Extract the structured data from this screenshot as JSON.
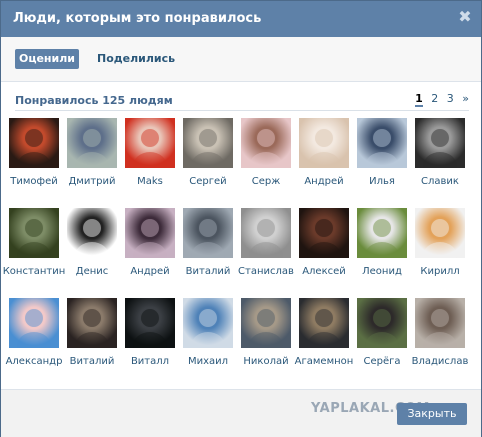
{
  "dialog": {
    "title": "Люди, которым это понравилось",
    "close_glyph": "✖",
    "tabs": [
      {
        "label": "Оценили",
        "active": true
      },
      {
        "label": "Поделились",
        "active": false
      }
    ],
    "summary": "Понравилось 125 людям",
    "pager": [
      "1",
      "2",
      "3",
      "»"
    ],
    "people": [
      {
        "name": "Тимофей",
        "c1": "#2a1a14",
        "c2": "#c24a2c"
      },
      {
        "name": "Дмитрий",
        "c1": "#a8b6b0",
        "c2": "#5e6f8a"
      },
      {
        "name": "Maks",
        "c1": "#d03020",
        "c2": "#e9c5b8"
      },
      {
        "name": "Сергей",
        "c1": "#6e6a63",
        "c2": "#c9c1b4"
      },
      {
        "name": "Серж",
        "c1": "#e7c6c8",
        "c2": "#9b6a5a"
      },
      {
        "name": "Андрей",
        "c1": "#d9c3ae",
        "c2": "#f3e9e0"
      },
      {
        "name": "Илья",
        "c1": "#b8c8d9",
        "c2": "#3a4d6a"
      },
      {
        "name": "Славик",
        "c1": "#2b2b2b",
        "c2": "#9a9a9a"
      },
      {
        "name": "Константин",
        "c1": "#34411f",
        "c2": "#7d8c66"
      },
      {
        "name": "Денис",
        "c1": "#ffffff",
        "c2": "#222222"
      },
      {
        "name": "Андрей",
        "c1": "#c7b0c2",
        "c2": "#3d2b3a"
      },
      {
        "name": "Виталий",
        "c1": "#9fa9b3",
        "c2": "#4c5560"
      },
      {
        "name": "Станислав",
        "c1": "#8f8f8f",
        "c2": "#d0d0d0"
      },
      {
        "name": "Алексей",
        "c1": "#1f1410",
        "c2": "#6a3a2a"
      },
      {
        "name": "Леонид",
        "c1": "#6a8c3c",
        "c2": "#e6e6e6"
      },
      {
        "name": "Кирилл",
        "c1": "#f1f1f1",
        "c2": "#e3a25a"
      },
      {
        "name": "Александр",
        "c1": "#4a8fd2",
        "c2": "#f2c9c9"
      },
      {
        "name": "Виталий",
        "c1": "#2a2322",
        "c2": "#8a7a6a"
      },
      {
        "name": "Виталл",
        "c1": "#0d1112",
        "c2": "#3b3f44"
      },
      {
        "name": "Михаил",
        "c1": "#d0dbe6",
        "c2": "#4f82b8"
      },
      {
        "name": "Николай",
        "c1": "#4d5a69",
        "c2": "#a59988"
      },
      {
        "name": "Агамемнон",
        "c1": "#2a2c30",
        "c2": "#8e7b62"
      },
      {
        "name": "Серёга",
        "c1": "#5b6f44",
        "c2": "#2d2a2a"
      },
      {
        "name": "Владислав",
        "c1": "#b8b0a8",
        "c2": "#6e5e54"
      }
    ],
    "watermark": "YAPLAKAL.COM",
    "close_button": "Закрыть",
    "colors": {
      "accent": "#5e81a8",
      "link": "#2b587a"
    }
  }
}
